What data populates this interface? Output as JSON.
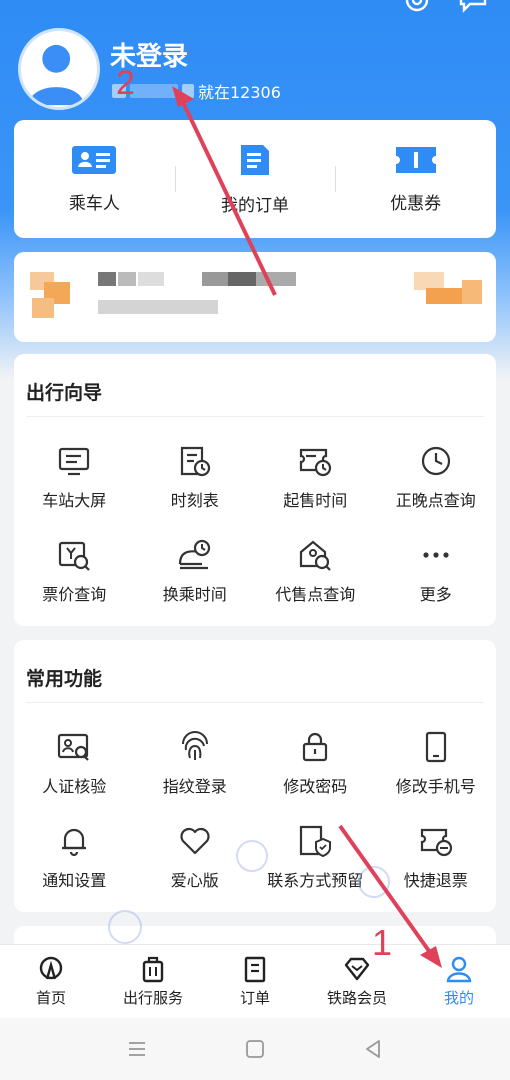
{
  "header": {
    "user_name": "未登录",
    "user_sub_suffix": "就在12306",
    "top_icons": [
      "gear-icon",
      "message-icon"
    ]
  },
  "quick_actions": [
    {
      "label": "乘车人",
      "icon": "id-card-icon"
    },
    {
      "label": "我的订单",
      "icon": "order-list-icon"
    },
    {
      "label": "优惠券",
      "icon": "coupon-icon"
    }
  ],
  "travel_guide": {
    "title": "出行向导",
    "items": [
      {
        "label": "车站大屏",
        "icon": "station-screen-icon"
      },
      {
        "label": "时刻表",
        "icon": "timetable-icon"
      },
      {
        "label": "起售时间",
        "icon": "sale-time-icon"
      },
      {
        "label": "正晚点查询",
        "icon": "clock-icon"
      },
      {
        "label": "票价查询",
        "icon": "fare-search-icon"
      },
      {
        "label": "换乘时间",
        "icon": "transfer-time-icon"
      },
      {
        "label": "代售点查询",
        "icon": "agency-search-icon"
      },
      {
        "label": "更多",
        "icon": "more-icon"
      }
    ]
  },
  "common_functions": {
    "title": "常用功能",
    "items": [
      {
        "label": "人证核验",
        "icon": "id-verify-icon"
      },
      {
        "label": "指纹登录",
        "icon": "fingerprint-icon"
      },
      {
        "label": "修改密码",
        "icon": "lock-icon"
      },
      {
        "label": "修改手机号",
        "icon": "phone-icon"
      },
      {
        "label": "通知设置",
        "icon": "bell-icon"
      },
      {
        "label": "爱心版",
        "icon": "heart-icon"
      },
      {
        "label": "联系方式预留",
        "icon": "contact-shield-icon"
      },
      {
        "label": "快捷退票",
        "icon": "refund-icon"
      }
    ]
  },
  "tabbar": [
    {
      "label": "首页",
      "icon": "home-train-icon",
      "active": false
    },
    {
      "label": "出行服务",
      "icon": "luggage-icon",
      "active": false
    },
    {
      "label": "订单",
      "icon": "order-icon",
      "active": false
    },
    {
      "label": "铁路会员",
      "icon": "diamond-icon",
      "active": false
    },
    {
      "label": "我的",
      "icon": "person-icon",
      "active": true
    }
  ],
  "annotations": {
    "marker_1": "1",
    "marker_2": "2",
    "arrow_color": "#e0415a"
  },
  "colors": {
    "brand_blue": "#2f8cf5",
    "text": "#222222",
    "background": "#f2f3f5"
  }
}
